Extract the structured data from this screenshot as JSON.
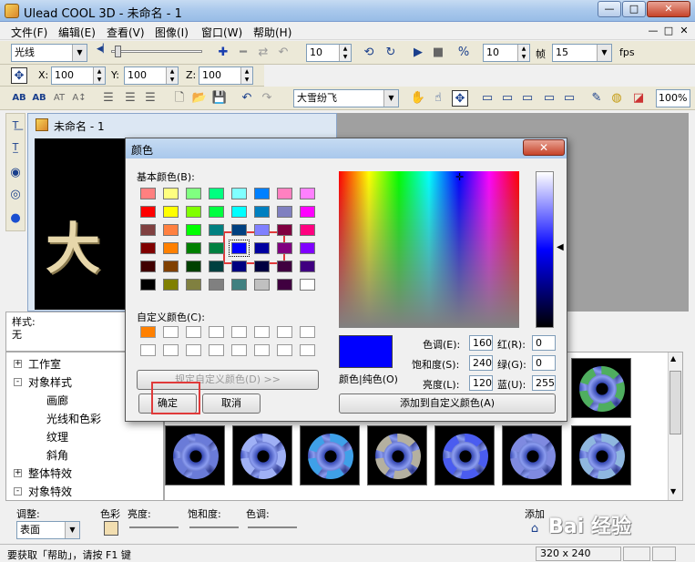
{
  "app": {
    "title": "Ulead COOL 3D - 未命名 - 1",
    "window_controls": {
      "minimize": "—",
      "maximize": "□",
      "close": "✕"
    }
  },
  "menu": [
    "文件(F)",
    "编辑(E)",
    "查看(V)",
    "图像(I)",
    "窗口(W)",
    "帮助(H)"
  ],
  "mdi_controls": [
    "—",
    "□",
    "✕"
  ],
  "toolbar1": {
    "style_select": "光线",
    "frame_value": "10",
    "speed_value": "10",
    "frame_label": "帧",
    "fps_value": "15",
    "fps_label": "fps"
  },
  "toolbar2": {
    "x_label": "X:",
    "x_value": "100",
    "y_label": "Y:",
    "y_value": "100",
    "z_label": "Z:",
    "z_value": "100"
  },
  "toolbar3": {
    "font_select": "大雪纷飞",
    "zoom_value": "100%"
  },
  "document": {
    "title": "未命名 - 1",
    "canvas_text": "大",
    "canvas_size": "320 x 240"
  },
  "style_panel": {
    "label": "样式:",
    "value": "无"
  },
  "tree": [
    {
      "label": "工作室",
      "level": 0,
      "toggle": "+"
    },
    {
      "label": "对象样式",
      "level": 0,
      "toggle": "-"
    },
    {
      "label": "画廊",
      "level": 1
    },
    {
      "label": "光线和色彩",
      "level": 1,
      "selected": true
    },
    {
      "label": "纹理",
      "level": 1
    },
    {
      "label": "斜角",
      "level": 1
    },
    {
      "label": "整体特效",
      "level": 0,
      "toggle": "+"
    },
    {
      "label": "对象特效",
      "level": 0,
      "toggle": "-"
    }
  ],
  "adjust": {
    "label": "调整:",
    "surface_select": "表面",
    "color_label": "色彩",
    "brightness_label": "亮度:",
    "saturation_label": "饱和度:",
    "hue_label": "色调:",
    "add_label": "添加"
  },
  "status": {
    "help_text": "要获取「帮助」，请按 F1 键",
    "size": "320 x 240"
  },
  "color_dialog": {
    "title": "颜色",
    "basic_colors_label": "基本颜色(B):",
    "custom_colors_label": "自定义颜色(C):",
    "define_custom_button": "规定自定义颜色(D) >>",
    "ok_button": "确定",
    "cancel_button": "取消",
    "add_custom_button": "添加到自定义颜色(A)",
    "solid_label": "颜色|纯色(O)",
    "hue_label": "色调(E):",
    "hue": "160",
    "sat_label": "饱和度(S):",
    "sat": "240",
    "lum_label": "亮度(L):",
    "lum": "120",
    "red_label": "红(R):",
    "red": "0",
    "green_label": "绿(G):",
    "green": "0",
    "blue_label": "蓝(U):",
    "blue": "255",
    "basic_colors": [
      [
        "#ff8080",
        "#ffff80",
        "#80ff80",
        "#00ff80",
        "#80ffff",
        "#0080ff",
        "#ff80c0",
        "#ff80ff"
      ],
      [
        "#ff0000",
        "#ffff00",
        "#80ff00",
        "#00ff40",
        "#00ffff",
        "#0080c0",
        "#8080c0",
        "#ff00ff"
      ],
      [
        "#804040",
        "#ff8040",
        "#00ff00",
        "#008080",
        "#004080",
        "#8080ff",
        "#800040",
        "#ff0080"
      ],
      [
        "#800000",
        "#ff8000",
        "#008000",
        "#008040",
        "#0000ff",
        "#0000a0",
        "#800080",
        "#8000ff"
      ],
      [
        "#400000",
        "#804000",
        "#004000",
        "#004040",
        "#000080",
        "#000040",
        "#400040",
        "#400080"
      ],
      [
        "#000000",
        "#808000",
        "#808040",
        "#808080",
        "#408080",
        "#c0c0c0",
        "#400040",
        "#ffffff"
      ]
    ],
    "custom_colors": [
      "#ff8000",
      "#ffffff",
      "#ffffff",
      "#ffffff",
      "#ffffff",
      "#ffffff",
      "#ffffff",
      "#ffffff",
      "#ffffff",
      "#ffffff",
      "#ffffff",
      "#ffffff",
      "#ffffff",
      "#ffffff",
      "#ffffff",
      "#ffffff"
    ],
    "selected_color": "#0000ff"
  },
  "watermark": "Bai 经验"
}
